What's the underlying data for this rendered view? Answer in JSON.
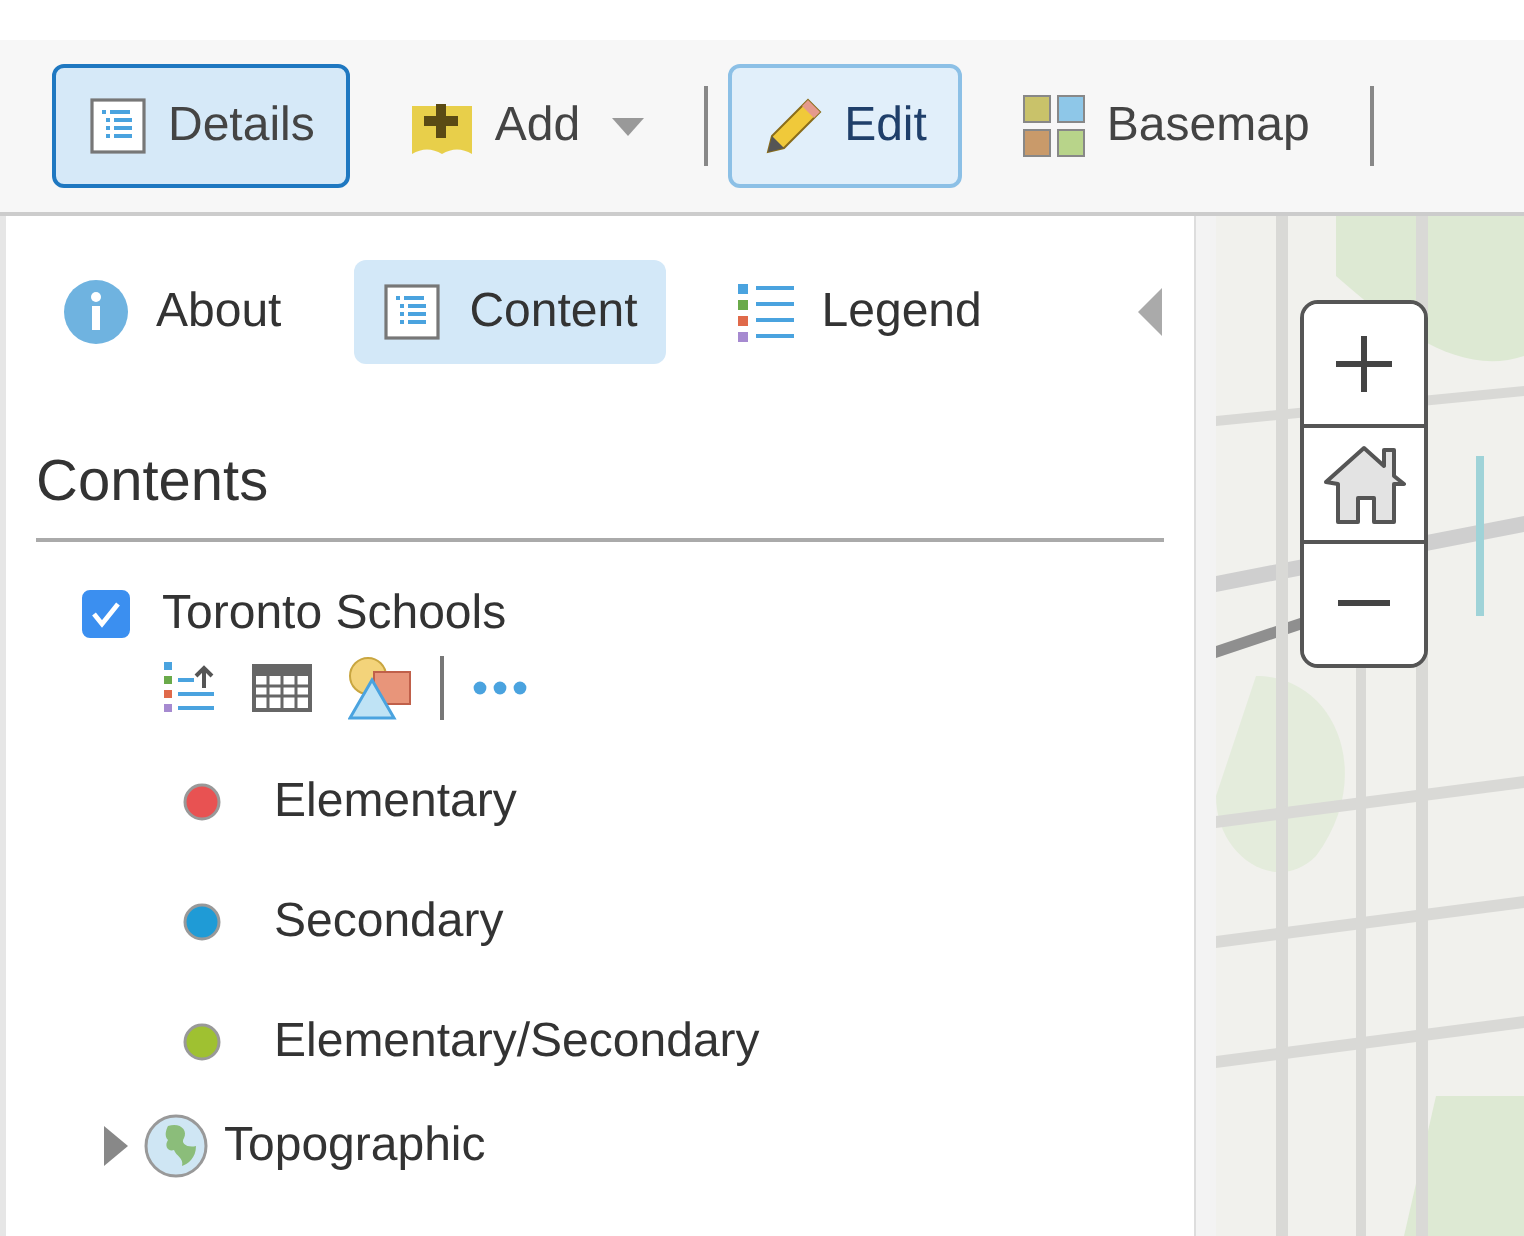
{
  "toolbar": {
    "buttons": [
      {
        "label": "Details",
        "selected": true,
        "dropdown": false
      },
      {
        "label": "Add",
        "selected": false,
        "dropdown": true
      },
      {
        "label": "Edit",
        "selected": true,
        "dropdown": false
      },
      {
        "label": "Basemap",
        "selected": false,
        "dropdown": false
      }
    ]
  },
  "tabs": [
    {
      "label": "About",
      "selected": false
    },
    {
      "label": "Content",
      "selected": true
    },
    {
      "label": "Legend",
      "selected": false
    }
  ],
  "contents": {
    "title": "Contents",
    "layers": [
      {
        "kind": "feature",
        "name": "Toronto Schools",
        "checked": true,
        "legend": [
          {
            "label": "Elementary",
            "color": "#e85252"
          },
          {
            "label": "Secondary",
            "color": "#1f9bd6"
          },
          {
            "label": "Elementary/Secondary",
            "color": "#9fc131"
          }
        ]
      },
      {
        "kind": "basemap",
        "name": "Topographic",
        "expanded": false
      }
    ]
  }
}
